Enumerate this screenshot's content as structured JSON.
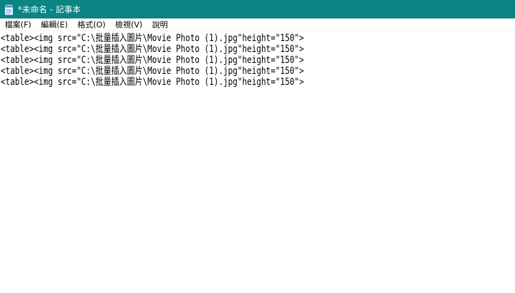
{
  "window": {
    "title": "*未命名 - 記事本",
    "icon": "notepad-icon",
    "titlebar_color": "#0b8484"
  },
  "menu": {
    "items": [
      {
        "name": "menu-file",
        "label": "檔案(F)"
      },
      {
        "name": "menu-edit",
        "label": "編輯(E)"
      },
      {
        "name": "menu-format",
        "label": "格式(O)"
      },
      {
        "name": "menu-view",
        "label": "檢視(V)"
      },
      {
        "name": "menu-help",
        "label": "說明"
      }
    ]
  },
  "editor": {
    "lines": [
      "<table><img src=\"C:\\批量插入圖片\\Movie Photo (1).jpg\"height=\"150\">",
      "<table><img src=\"C:\\批量插入圖片\\Movie Photo (1).jpg\"height=\"150\">",
      "<table><img src=\"C:\\批量插入圖片\\Movie Photo (1).jpg\"height=\"150\">",
      "<table><img src=\"C:\\批量插入圖片\\Movie Photo (1).jpg\"height=\"150\">",
      "<table><img src=\"C:\\批量插入圖片\\Movie Photo (1).jpg\"height=\"150\">"
    ]
  }
}
